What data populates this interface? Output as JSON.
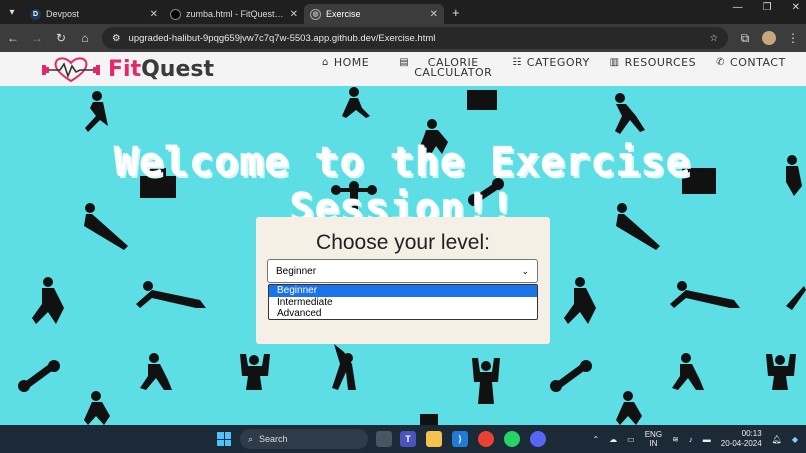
{
  "browser": {
    "tabs": [
      {
        "title": "Devpost",
        "favicon": "D",
        "active": false
      },
      {
        "title": "zumba.html - FitQuest [Codes",
        "favicon": "github-icon",
        "active": false
      },
      {
        "title": "Exercise",
        "favicon": "globe-icon",
        "active": true
      }
    ],
    "url": "upgraded-halibut-9pqg659jvw7c7q7w-5503.app.github.dev/Exercise.html"
  },
  "site": {
    "logo_fit": "Fit",
    "logo_quest": "Quest",
    "nav": [
      {
        "label": "HOME",
        "icon": "home-icon"
      },
      {
        "label": "CALORIE\nCALCULATOR",
        "label_line1": "CALORIE",
        "label_line2": "CALCULATOR",
        "icon": "calculator-icon"
      },
      {
        "label": "CATEGORY",
        "icon": "users-icon"
      },
      {
        "label": "RESOURCES",
        "icon": "book-icon"
      },
      {
        "label": "CONTACT",
        "icon": "phone-icon"
      }
    ]
  },
  "hero": {
    "title": "Welcome to the Exercise Session!!",
    "card_title": "Choose your level:",
    "select_value": "Beginner",
    "options": [
      "Beginner",
      "Intermediate",
      "Advanced"
    ],
    "selected_index": 0
  },
  "taskbar": {
    "search_placeholder": "Search",
    "lang_line1": "ENG",
    "lang_line2": "IN",
    "time": "00:13",
    "date": "20-04-2024"
  },
  "colors": {
    "hero_bg": "#5ddde4",
    "brand_pink": "#e3296b",
    "selected_option": "#1a73e8"
  }
}
